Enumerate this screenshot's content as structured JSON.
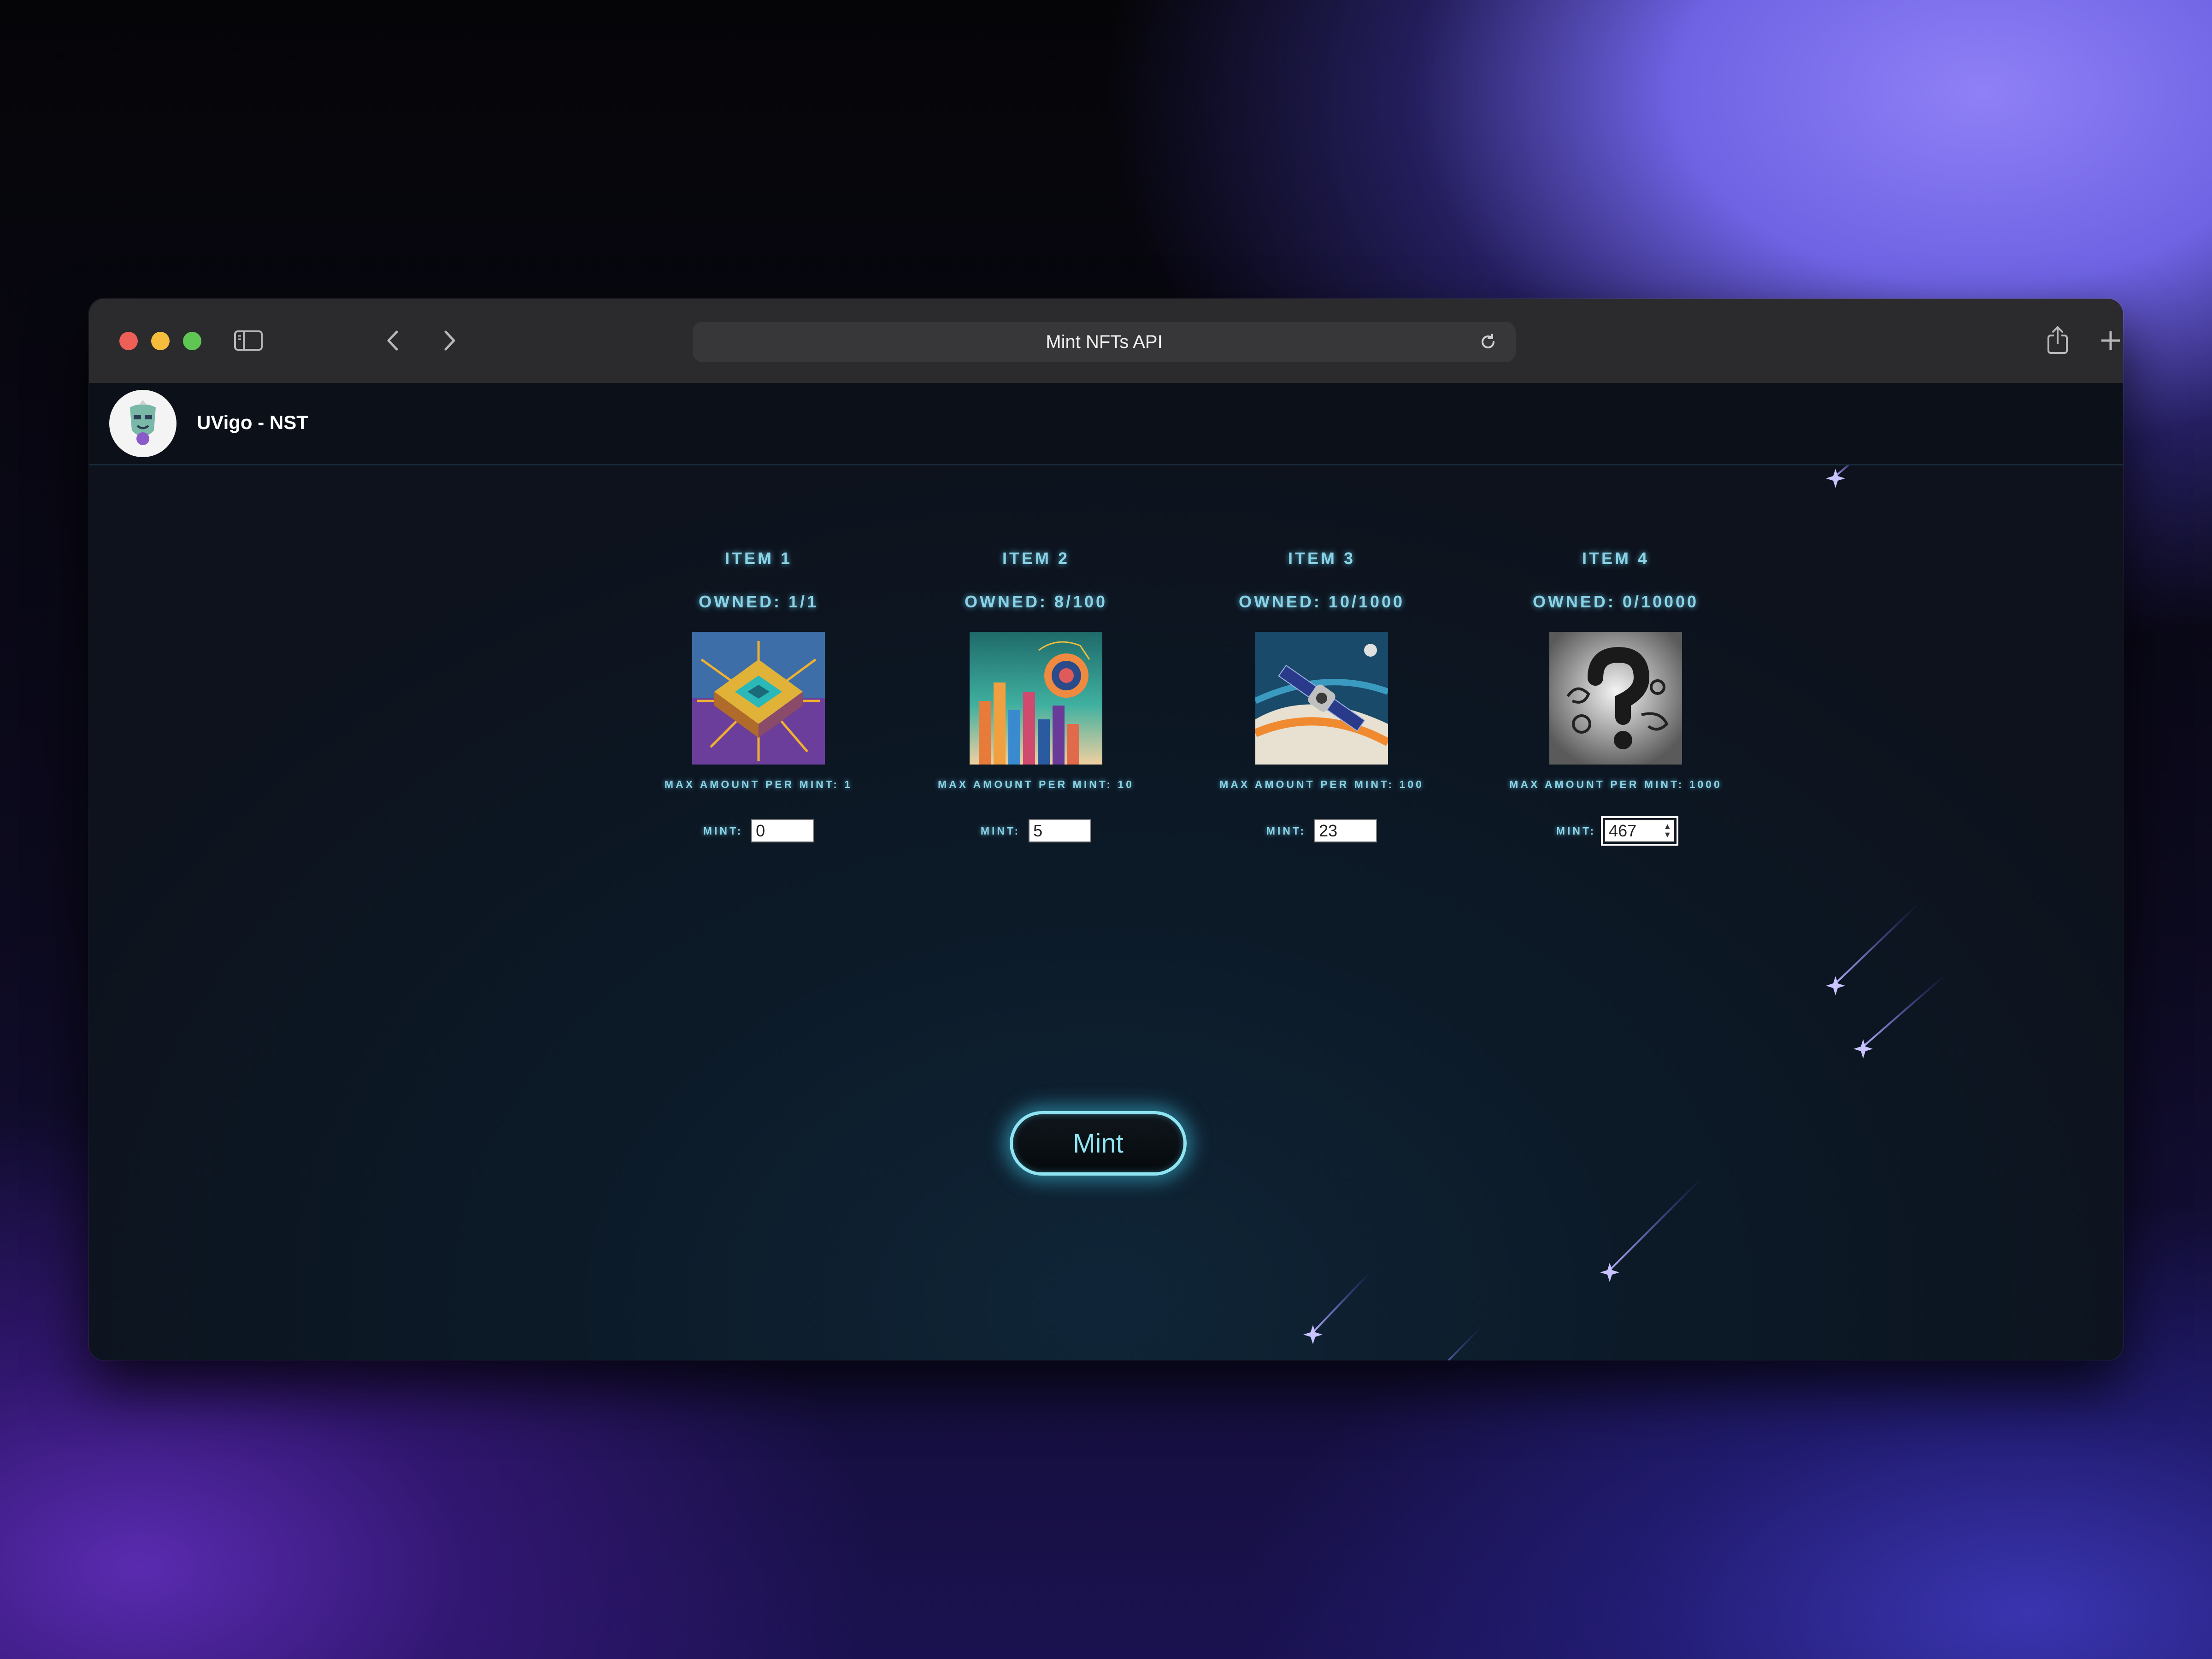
{
  "browser": {
    "address_title": "Mint NFTs API"
  },
  "app": {
    "brand": "UVigo - NST"
  },
  "items": [
    {
      "name": "ITEM 1",
      "owned": "OWNED: 1/1",
      "max": "MAX AMOUNT PER MINT: 1",
      "mint_label": "MINT:",
      "mint_value": "0",
      "image": "chip-artwork"
    },
    {
      "name": "ITEM 2",
      "owned": "OWNED: 8/100",
      "max": "MAX AMOUNT PER MINT: 10",
      "mint_label": "MINT:",
      "mint_value": "5",
      "image": "abstract-graph-artwork"
    },
    {
      "name": "ITEM 3",
      "owned": "OWNED: 10/1000",
      "max": "MAX AMOUNT PER MINT: 100",
      "mint_label": "MINT:",
      "mint_value": "23",
      "image": "satellite-artwork"
    },
    {
      "name": "ITEM 4",
      "owned": "OWNED: 0/10000",
      "max": "MAX AMOUNT PER MINT: 1000",
      "mint_label": "MINT:",
      "mint_value": "467",
      "image": "question-mark-artwork"
    }
  ],
  "mint_button": {
    "label": "Mint"
  },
  "colors": {
    "accent": "#8fe4f2",
    "text_glow": "#8ad3e6",
    "page_bg": "#0d121c"
  }
}
